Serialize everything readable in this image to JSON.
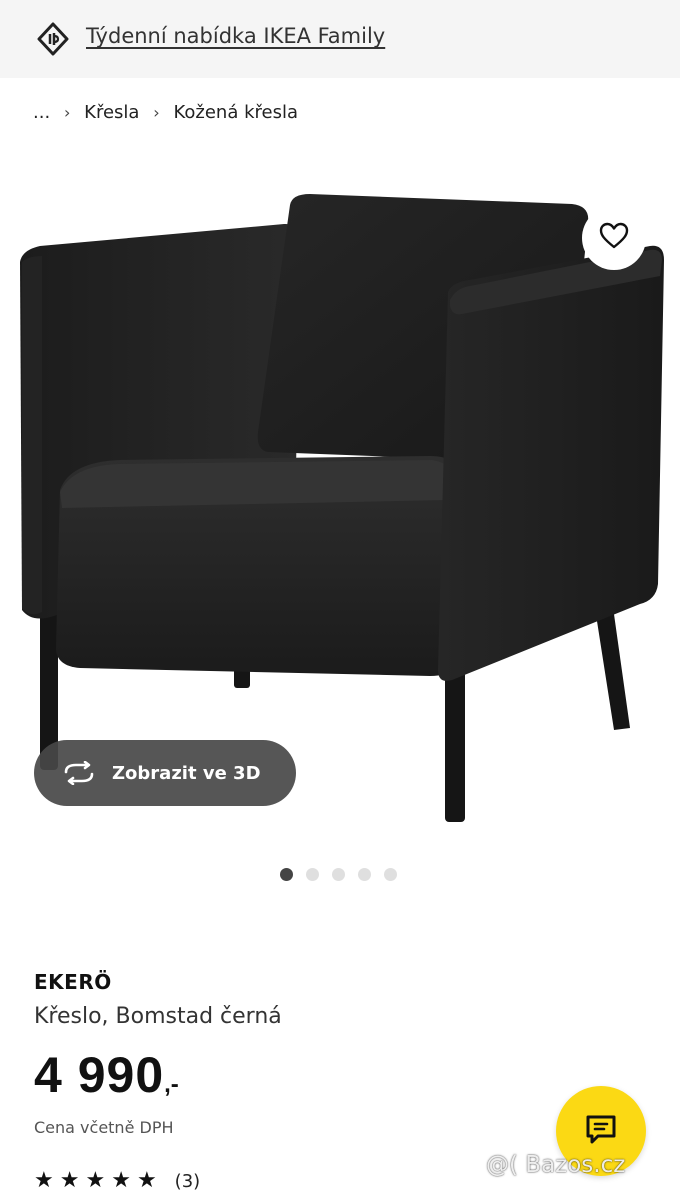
{
  "promo": {
    "link_text": "Týdenní nabídka IKEA Family",
    "icon": "price-tag-icon"
  },
  "breadcrumb": {
    "items": [
      "...",
      "Křesla",
      "Kožená křesla"
    ],
    "separator_icon": "chevron-right-icon"
  },
  "gallery": {
    "image": "black-armchair-product-photo",
    "favourite_icon": "heart-icon",
    "view_3d_label": "Zobrazit ve 3D",
    "view_3d_icon": "rotate-arrows-icon",
    "pagination": {
      "total": 5,
      "current": 1
    }
  },
  "product": {
    "name": "EKERÖ",
    "description": "Křeslo, Bomstad černá",
    "price": "4 990",
    "price_suffix": ",-",
    "price_note": "Cena včetně DPH",
    "rating": {
      "stars": 5,
      "max": 5,
      "count_label": "(3)"
    }
  },
  "chat": {
    "icon": "chat-bubble-icon"
  },
  "watermark": {
    "text": "@( Bazos.cz"
  },
  "colors": {
    "promo_bg": "#f5f5f5",
    "chat_button": "#fbd914",
    "view_3d_button": "#484848",
    "text_primary": "#111111"
  }
}
